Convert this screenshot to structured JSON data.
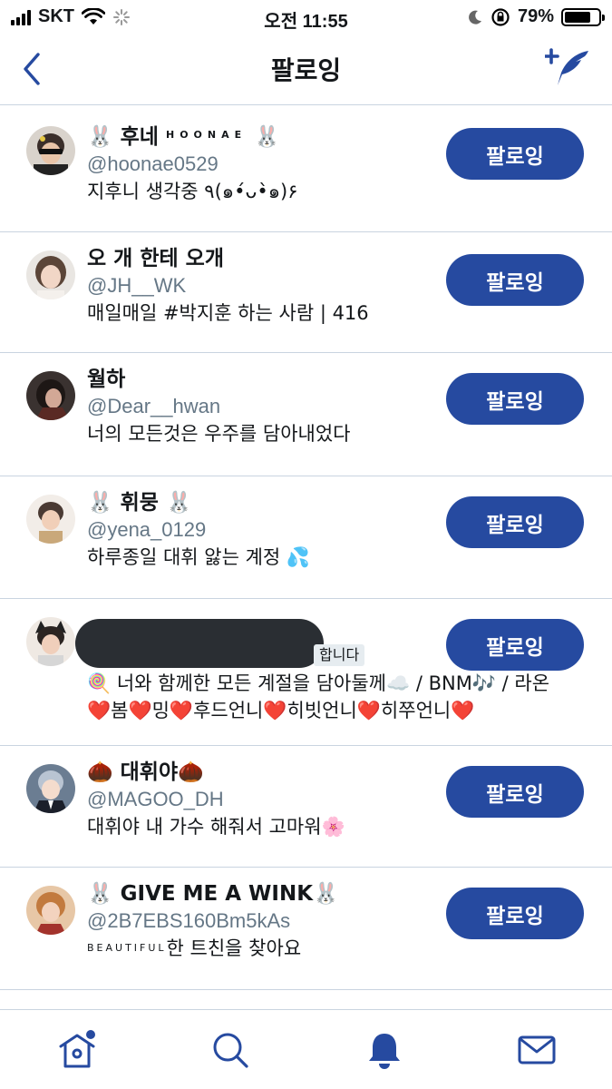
{
  "status_bar": {
    "carrier": "SKT",
    "time": "오전 11:55",
    "battery": "79%",
    "battery_level": 0.79
  },
  "nav": {
    "title": "팔로잉",
    "back_icon": "chevron-left-icon",
    "compose_icon": "add-feather-icon"
  },
  "accent_color": "#264aa0",
  "users": [
    {
      "name_prefix": "🐰 후네 ",
      "name_caps": "HOONAE",
      "name_suffix": " 🐰",
      "handle": "@hoonae0529",
      "bio": "지후니 생각중 ٩(๑•́ᴗ•̀๑)۶",
      "button": "팔로잉"
    },
    {
      "name_prefix": "오 개 한테 오개",
      "name_caps": "",
      "name_suffix": "",
      "handle": "@JH__WK",
      "bio": "매일매일 #박지훈 하는 사람 | 416",
      "button": "팔로잉"
    },
    {
      "name_prefix": "월하",
      "name_caps": "",
      "name_suffix": "",
      "handle": "@Dear__hwan",
      "bio": "너의 모든것은 우주를 담아내었다",
      "button": "팔로잉"
    },
    {
      "name_prefix": "🐰 휘뭉 🐰",
      "name_caps": "",
      "name_suffix": "",
      "handle": "@yena_0129",
      "bio": "하루종일 대휘 앓는 계정 💦",
      "button": "팔로잉"
    },
    {
      "badge": "합니다",
      "bio_line1": "🍭 너와 함께한 모든 계절을 담아둘께☁️ / BNM🎶 / 라온",
      "bio_line2": "❤️봄❤️밍❤️후드언니❤️히빗언니❤️히쭈언니❤️",
      "button": "팔로잉"
    },
    {
      "name_prefix": "🌰 대휘야🌰",
      "name_caps": "",
      "name_suffix": "",
      "handle": "@MAGOO_DH",
      "bio": "대휘야 내 가수 해줘서 고마워🌸",
      "button": "팔로잉"
    },
    {
      "name_prefix": "🐰 GIVE ME A WINK🐰",
      "name_caps": "",
      "name_suffix": "",
      "handle": "@2B7EBS160Bm5kAs",
      "bio_caps": "BEAUTIFUL",
      "bio": "한 트친을 찾아요",
      "button": "팔로잉"
    }
  ],
  "tabs": [
    {
      "icon": "home-icon",
      "notification_dot": true
    },
    {
      "icon": "search-icon"
    },
    {
      "icon": "bell-icon",
      "active": true
    },
    {
      "icon": "mail-icon"
    }
  ]
}
